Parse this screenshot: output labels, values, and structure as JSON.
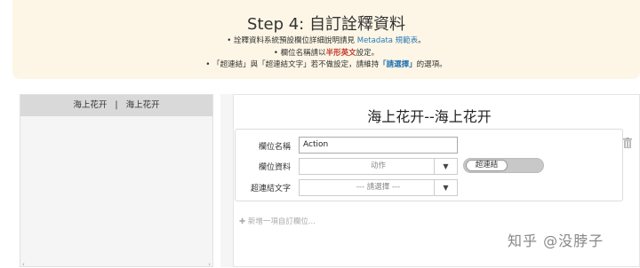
{
  "banner": {
    "title": "Step 4: 自訂詮釋資料",
    "note1_prefix": "詮釋資料系統預設欄位詳細說明請見 ",
    "note1_link": "Metadata 規範表",
    "note1_suffix": "。",
    "note2_prefix": "欄位名稱請以",
    "note2_emph": "半形英文",
    "note2_suffix": "設定。",
    "note3_prefix": "「超連結」與「超連結文字」若不做設定，請維持",
    "note3_emph": "「請選擇」",
    "note3_suffix": "的選項。"
  },
  "left_panel": {
    "tab_left": "海上花开",
    "tab_sep": "|",
    "tab_right": "海上花开"
  },
  "card": {
    "title": "海上花开--海上花开",
    "field_name_label": "欄位名稱",
    "field_name_value": "Action",
    "field_data_label": "欄位資料",
    "field_data_value": "动作",
    "link_text_label": "超連結文字",
    "link_text_value": "--- 請選擇 ---",
    "hyperlink_toggle": "超連結",
    "add_field": "✚ 新增一項自訂欄位..."
  },
  "watermark": "知乎 @没脖子"
}
